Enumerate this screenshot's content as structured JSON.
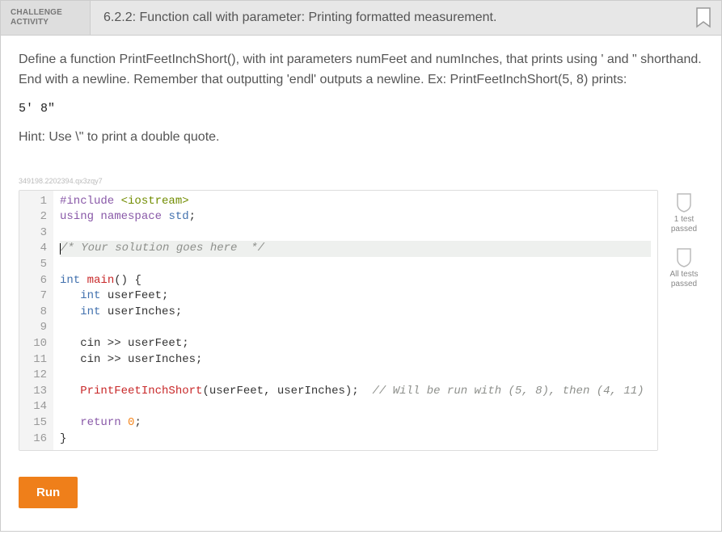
{
  "header": {
    "badge_line1": "CHALLENGE",
    "badge_line2": "ACTIVITY",
    "title": "6.2.2: Function call with parameter: Printing formatted measurement."
  },
  "instructions": "Define a function PrintFeetInchShort(), with int parameters numFeet and numInches, that prints using ' and \" shorthand. End with a newline. Remember that outputting 'endl' outputs a newline. Ex: PrintFeetInchShort(5, 8) prints:",
  "example_output": "5' 8\"",
  "hint": "Hint: Use \\\" to print a double quote.",
  "watermark": "349198.2202394.qx3zqy7",
  "editor": {
    "gutter_start": 1,
    "gutter_end": 16,
    "highlight_line": 4,
    "lines": [
      {
        "tokens": [
          [
            "pp",
            "#include"
          ],
          [
            "",
            " "
          ],
          [
            "str",
            "<iostream>"
          ]
        ]
      },
      {
        "tokens": [
          [
            "kw",
            "using"
          ],
          [
            "",
            " "
          ],
          [
            "kw",
            "namespace"
          ],
          [
            "",
            " "
          ],
          [
            "ns",
            "std"
          ],
          [
            "",
            ";"
          ]
        ]
      },
      {
        "tokens": [
          [
            "",
            ""
          ]
        ]
      },
      {
        "tokens": [
          [
            "cursor",
            ""
          ],
          [
            "com",
            "/* Your solution goes here  */"
          ]
        ]
      },
      {
        "tokens": [
          [
            "",
            ""
          ]
        ]
      },
      {
        "tokens": [
          [
            "type",
            "int"
          ],
          [
            "",
            " "
          ],
          [
            "fn",
            "main"
          ],
          [
            "",
            "() {"
          ]
        ]
      },
      {
        "tokens": [
          [
            "",
            "   "
          ],
          [
            "type",
            "int"
          ],
          [
            "",
            " userFeet;"
          ]
        ]
      },
      {
        "tokens": [
          [
            "",
            "   "
          ],
          [
            "type",
            "int"
          ],
          [
            "",
            " userInches;"
          ]
        ]
      },
      {
        "tokens": [
          [
            "",
            ""
          ]
        ]
      },
      {
        "tokens": [
          [
            "",
            "   cin >> userFeet;"
          ]
        ]
      },
      {
        "tokens": [
          [
            "",
            "   cin >> userInches;"
          ]
        ]
      },
      {
        "tokens": [
          [
            "",
            ""
          ]
        ]
      },
      {
        "tokens": [
          [
            "",
            "   "
          ],
          [
            "fn",
            "PrintFeetInchShort"
          ],
          [
            "",
            "(userFeet, userInches);  "
          ],
          [
            "com",
            "// Will be run with (5, 8), then (4, 11)"
          ]
        ]
      },
      {
        "tokens": [
          [
            "",
            ""
          ]
        ]
      },
      {
        "tokens": [
          [
            "",
            "   "
          ],
          [
            "kw",
            "return"
          ],
          [
            "",
            " "
          ],
          [
            "num",
            "0"
          ],
          [
            "",
            ";"
          ]
        ]
      },
      {
        "tokens": [
          [
            "",
            "}"
          ]
        ]
      }
    ]
  },
  "badges": {
    "one_test": "1 test\npassed",
    "all_tests": "All tests\npassed"
  },
  "buttons": {
    "run": "Run"
  }
}
